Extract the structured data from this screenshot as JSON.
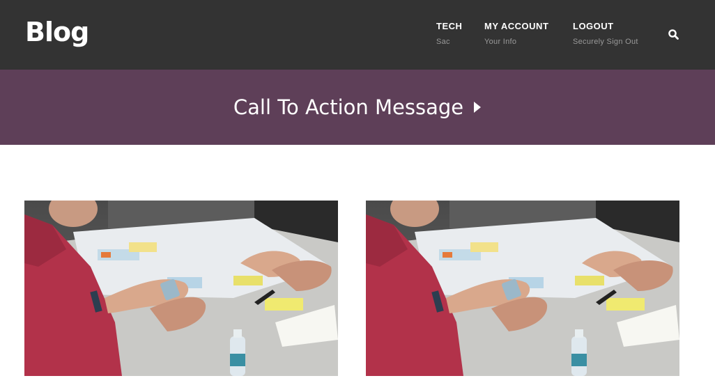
{
  "site": {
    "logo": "Blog"
  },
  "nav": {
    "items": [
      {
        "title": "TECH",
        "subtitle": "Sac"
      },
      {
        "title": "MY ACCOUNT",
        "subtitle": "Your Info"
      },
      {
        "title": "LOGOUT",
        "subtitle": "Securely Sign Out"
      }
    ],
    "search_icon": "search-icon"
  },
  "cta": {
    "text": "Call To Action Message",
    "icon": "caret-right-icon"
  },
  "colors": {
    "header_bg": "#333333",
    "cta_bg": "#5e3f58",
    "nav_sub": "#9a9a9a"
  },
  "posts": [
    {
      "image": "team-meeting-photo"
    },
    {
      "image": "team-meeting-photo"
    }
  ]
}
